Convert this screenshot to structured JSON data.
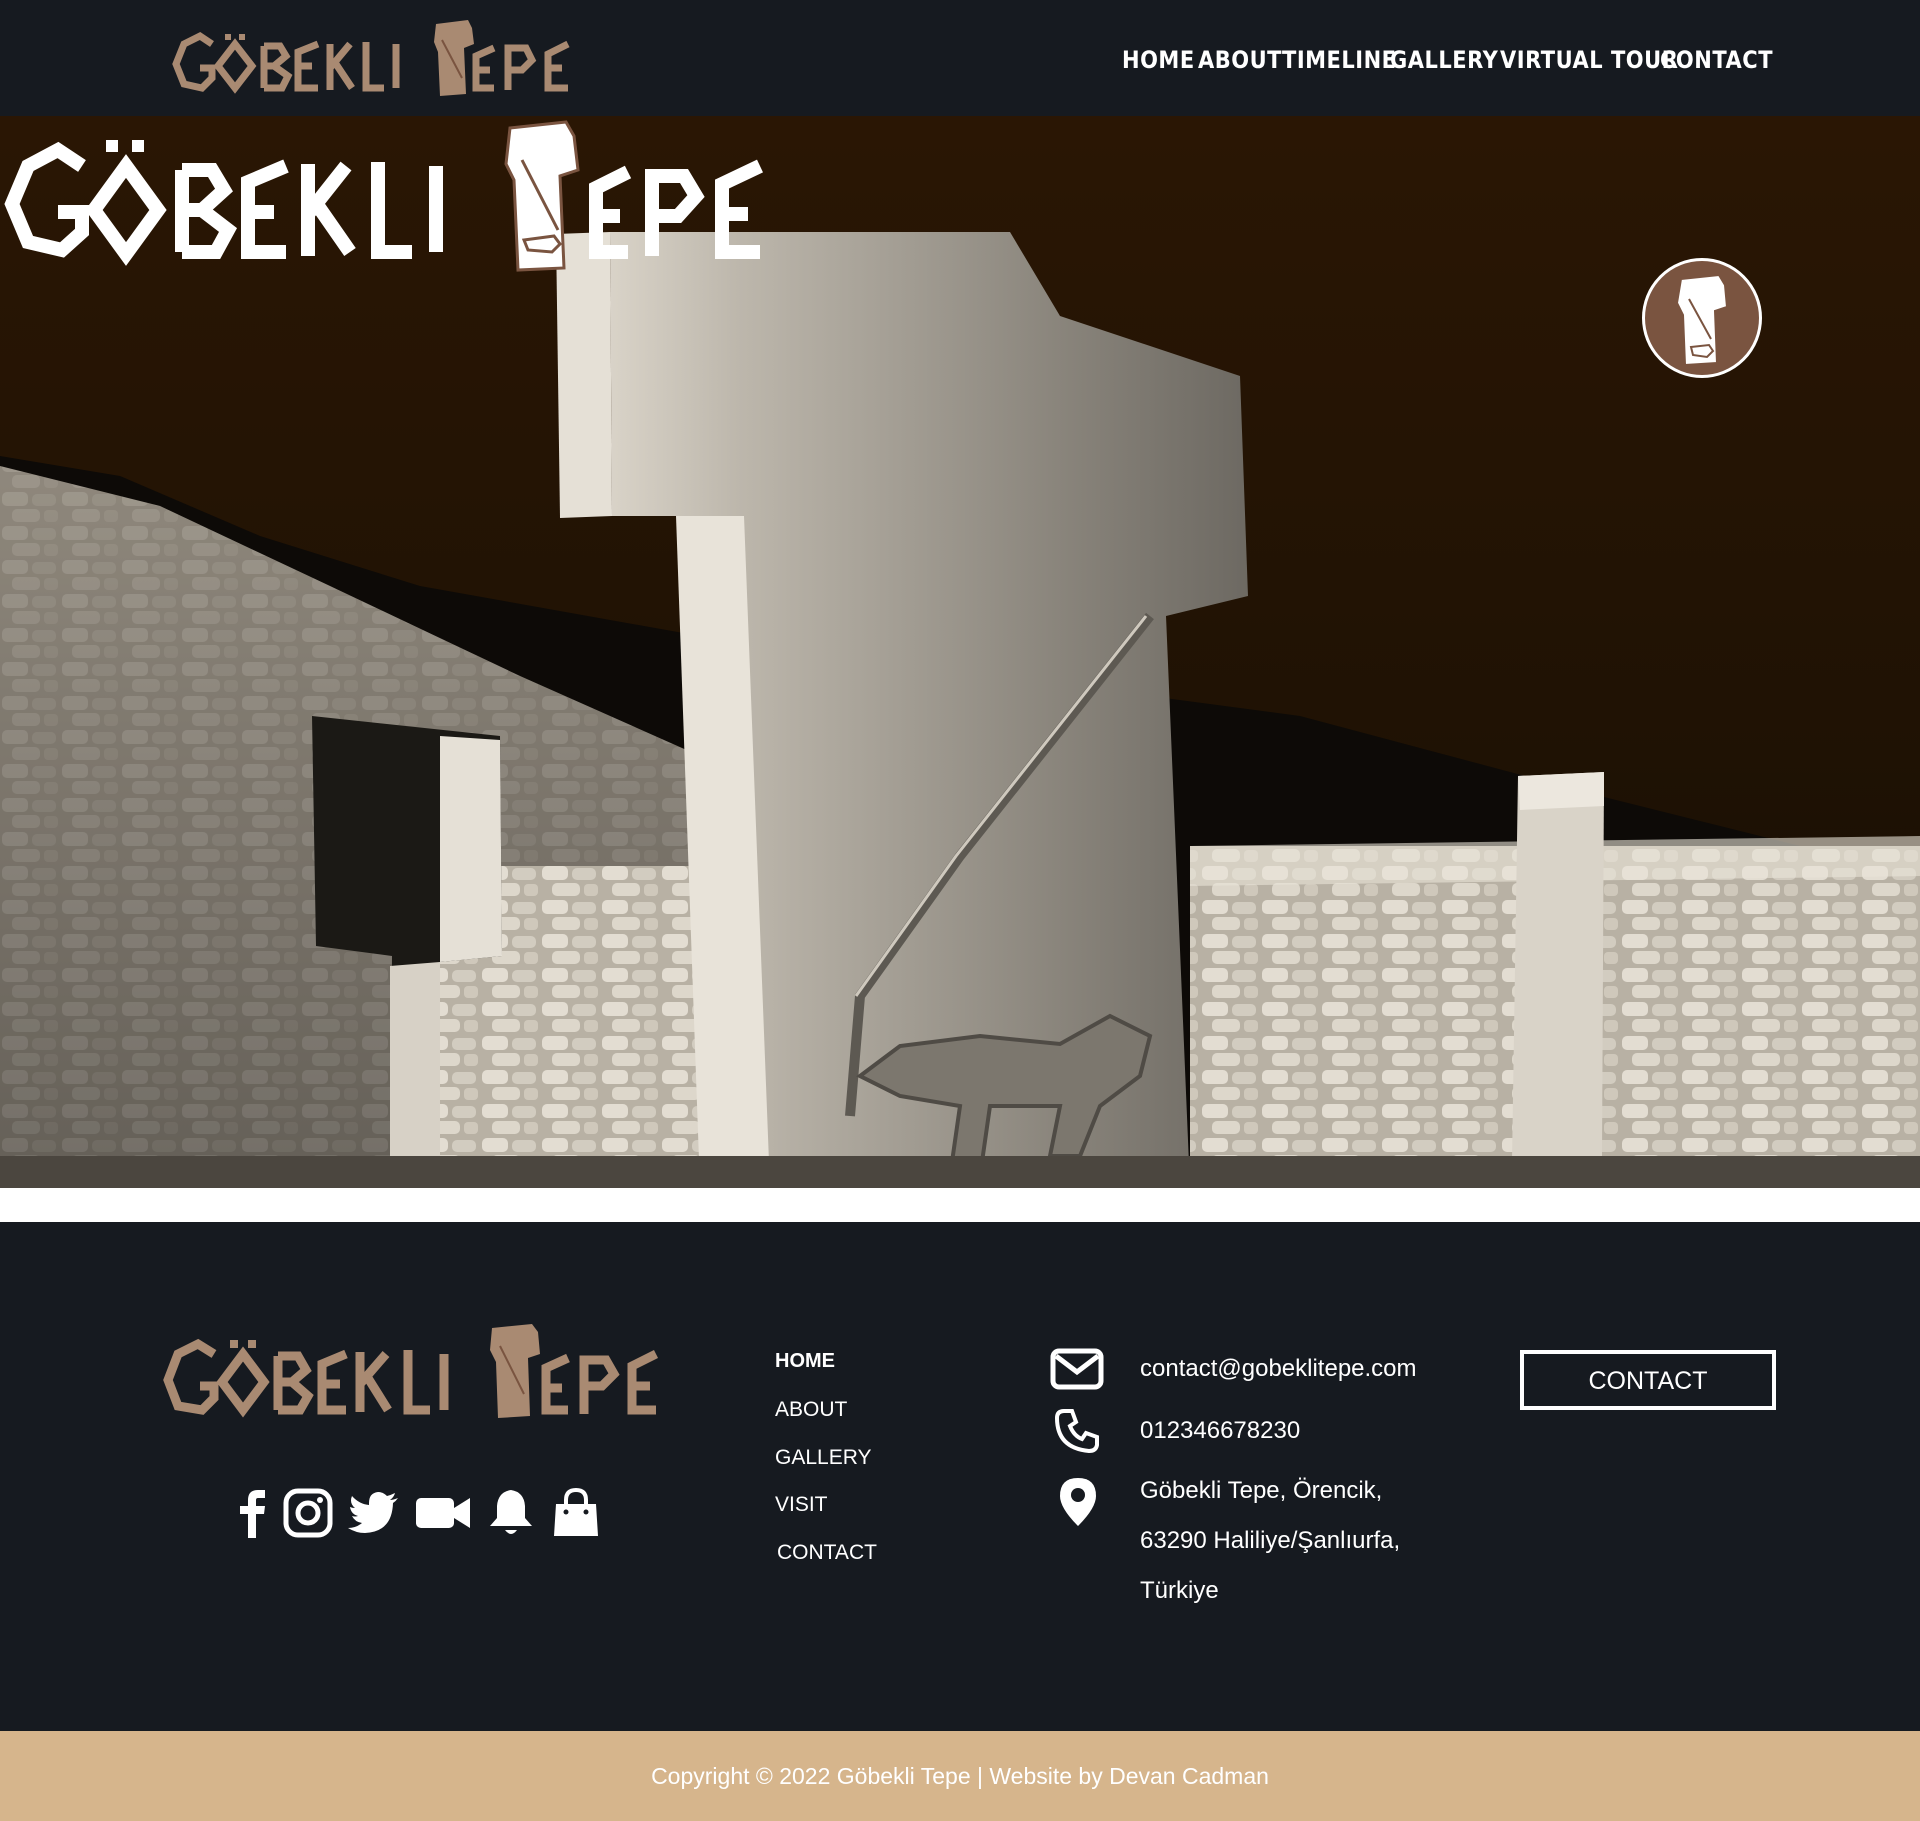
{
  "brand": {
    "logo_text": "GÖBEKLI TEPE",
    "logo_color": "#a98a72",
    "hero_logo_color": "#ffffff",
    "accent_brown": "#7a5440"
  },
  "nav": {
    "items": [
      {
        "label": "HOME"
      },
      {
        "label": "ABOUT"
      },
      {
        "label": "TIMELINE"
      },
      {
        "label": "GALLERY"
      },
      {
        "label": "VIRTUAL TOUR"
      },
      {
        "label": "CONTACT"
      }
    ]
  },
  "footer": {
    "social_icons": [
      "facebook-icon",
      "instagram-icon",
      "twitter-icon",
      "video-camera-icon",
      "bell-icon",
      "shopping-bag-icon"
    ],
    "links": [
      {
        "label": "HOME"
      },
      {
        "label": "ABOUT"
      },
      {
        "label": "GALLERY"
      },
      {
        "label": "VISIT"
      },
      {
        "label": "CONTACT"
      }
    ],
    "email": "contact@gobeklitepe.com",
    "phone": "012346678230",
    "address_lines": [
      "Göbekli Tepe, Örencik,",
      "63290 Haliliye/Şanlıurfa,",
      "Türkiye"
    ],
    "contact_button": "CONTACT",
    "copyright": "Copyright © 2022 Göbekli Tepe | Website by Devan Cadman",
    "background": "#161a20",
    "copyright_background": "#d6b58c"
  }
}
